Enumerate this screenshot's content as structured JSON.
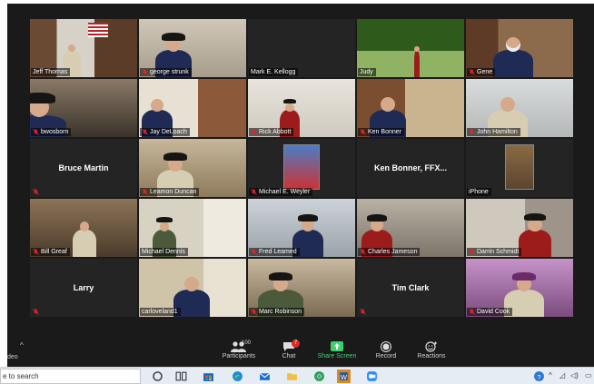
{
  "participants": [
    {
      "id": "jeff",
      "name": "Jeff Thomas",
      "mic_muted": false,
      "type": "video"
    },
    {
      "id": "george",
      "name": "george strunk",
      "mic_muted": true,
      "type": "video"
    },
    {
      "id": "mark",
      "name": "Mark E. Kellogg",
      "mic_muted": false,
      "type": "name-only-tag"
    },
    {
      "id": "judy",
      "name": "Judy",
      "mic_muted": false,
      "type": "video",
      "active_speaker": true
    },
    {
      "id": "gene",
      "name": "Gene",
      "mic_muted": true,
      "type": "video"
    },
    {
      "id": "bwosborn",
      "name": "bwosborn",
      "mic_muted": true,
      "type": "video"
    },
    {
      "id": "jay",
      "name": "Jay DeLoach",
      "mic_muted": true,
      "type": "video"
    },
    {
      "id": "rick",
      "name": "Rick Abbott",
      "mic_muted": true,
      "type": "video"
    },
    {
      "id": "kenb1",
      "name": "Ken Bonner",
      "mic_muted": true,
      "type": "video"
    },
    {
      "id": "john",
      "name": "John Hamilton",
      "mic_muted": true,
      "type": "video"
    },
    {
      "id": "bruce",
      "name": "Bruce Martin",
      "mic_muted": true,
      "type": "name-only"
    },
    {
      "id": "leamon",
      "name": "Leamon Duncan",
      "mic_muted": true,
      "type": "video"
    },
    {
      "id": "michaelw",
      "name": "Michael E. Weyler",
      "mic_muted": true,
      "type": "photo"
    },
    {
      "id": "kenb2",
      "name": "Ken Bonner, FFX...",
      "mic_muted": false,
      "type": "name-only"
    },
    {
      "id": "iphone",
      "name": "iPhone",
      "mic_muted": false,
      "type": "photo"
    },
    {
      "id": "bill",
      "name": "Bill Greaf",
      "mic_muted": true,
      "type": "video"
    },
    {
      "id": "michaeld",
      "name": "Michael Dennis",
      "mic_muted": false,
      "type": "video"
    },
    {
      "id": "fred",
      "name": "Fred Leamed",
      "mic_muted": true,
      "type": "video"
    },
    {
      "id": "charles",
      "name": "Charles Jameson",
      "mic_muted": true,
      "type": "video"
    },
    {
      "id": "darrin",
      "name": "Darrin Schmidt",
      "mic_muted": true,
      "type": "video"
    },
    {
      "id": "larry",
      "name": "Larry",
      "mic_muted": true,
      "type": "name-only"
    },
    {
      "id": "carlo",
      "name": "carloveland1",
      "mic_muted": false,
      "type": "video"
    },
    {
      "id": "marc",
      "name": "Marc Robinson",
      "mic_muted": true,
      "type": "video"
    },
    {
      "id": "tim",
      "name": "Tim Clark",
      "mic_muted": true,
      "type": "name-only"
    },
    {
      "id": "david",
      "name": "David Cook",
      "mic_muted": true,
      "type": "video"
    }
  ],
  "toolbar": {
    "left_label": "deo",
    "participants_label": "Participants",
    "participants_count": "100",
    "chat_label": "Chat",
    "chat_badge": "7",
    "share_label": "Share Screen",
    "record_label": "Record",
    "reactions_label": "Reactions"
  },
  "taskbar": {
    "search_text": "e to search",
    "icons": [
      "search-circle-icon",
      "task-view-icon",
      "store-icon",
      "edge-icon",
      "mail-icon",
      "file-explorer-icon",
      "chrome-icon",
      "word-icon",
      "zoom-icon"
    ],
    "mail_badge": "1"
  },
  "colors": {
    "active_speaker_border": "#c6e24a",
    "muted_mic": "#e02828",
    "share_green": "#3bd16f",
    "toolbar_bg": "#1a1a1a"
  }
}
